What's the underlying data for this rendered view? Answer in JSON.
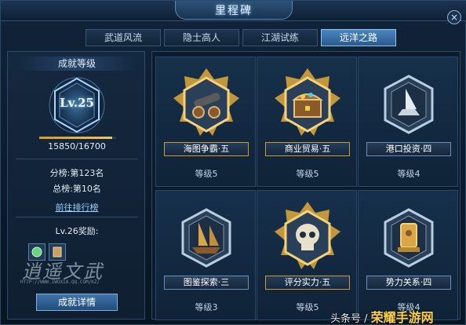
{
  "window": {
    "title": "里程碑",
    "close_glyph": "×"
  },
  "tabs": [
    {
      "label": "武道风流",
      "active": false
    },
    {
      "label": "隐士高人",
      "active": false
    },
    {
      "label": "江湖试练",
      "active": false
    },
    {
      "label": "远洋之路",
      "active": true
    }
  ],
  "left_panel": {
    "title": "成就等级",
    "level": "Lv.25",
    "exp_text": "15850/16700",
    "exp_progress": 0.949,
    "sub_rank": "分榜:第123名",
    "total_rank": "总榜:第10名",
    "rank_link": "前往排行榜",
    "reward_title": "Lv.26奖励:",
    "detail_button": "成就详情",
    "watermark_url": "HTTP://WWW.IWUXIA.QQ.COM/KZ/"
  },
  "achievements": [
    {
      "name": "海图争霸·五",
      "level": "等级5",
      "tier": "gold",
      "icon": "cannon-icon"
    },
    {
      "name": "商业贸易·五",
      "level": "等级5",
      "tier": "gold",
      "icon": "treasure-chest-icon"
    },
    {
      "name": "港口投资·四",
      "level": "等级4",
      "tier": "silver",
      "icon": "ship-icon"
    },
    {
      "name": "图鉴探索·三",
      "level": "等级3",
      "tier": "silver",
      "icon": "junk-ship-icon"
    },
    {
      "name": "评分实力·五",
      "level": "等级5",
      "tier": "gold",
      "icon": "skull-icon"
    },
    {
      "name": "势力关系·四",
      "level": "等级4",
      "tier": "silver",
      "icon": "golden-statue-icon"
    }
  ],
  "footer": {
    "text": "头条号 /",
    "brand": "荣耀手游网"
  },
  "colors": {
    "accent": "#4a86c0",
    "gold": "#e3a93a",
    "silver": "#9fb6cc",
    "background": "#0c1a2b"
  }
}
